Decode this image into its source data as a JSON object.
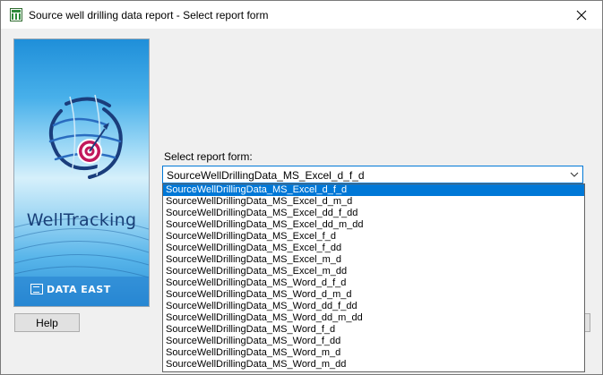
{
  "window": {
    "title": "Source well drilling data report - Select report form",
    "icon": "report-app-icon",
    "close_icon": "close-icon"
  },
  "banner": {
    "brand": "WellTracking",
    "company": "DATA EAST"
  },
  "form": {
    "label": "Select report form:",
    "selected": "SourceWellDrillingData_MS_Excel_d_f_d",
    "dropdown_open": true,
    "options": [
      "SourceWellDrillingData_MS_Excel_d_f_d",
      "SourceWellDrillingData_MS_Excel_d_m_d",
      "SourceWellDrillingData_MS_Excel_dd_f_dd",
      "SourceWellDrillingData_MS_Excel_dd_m_dd",
      "SourceWellDrillingData_MS_Excel_f_d",
      "SourceWellDrillingData_MS_Excel_f_dd",
      "SourceWellDrillingData_MS_Excel_m_d",
      "SourceWellDrillingData_MS_Excel_m_dd",
      "SourceWellDrillingData_MS_Word_d_f_d",
      "SourceWellDrillingData_MS_Word_d_m_d",
      "SourceWellDrillingData_MS_Word_dd_f_dd",
      "SourceWellDrillingData_MS_Word_dd_m_dd",
      "SourceWellDrillingData_MS_Word_f_d",
      "SourceWellDrillingData_MS_Word_f_dd",
      "SourceWellDrillingData_MS_Word_m_d",
      "SourceWellDrillingData_MS_Word_m_dd"
    ]
  },
  "buttons": {
    "help": "Help"
  },
  "colors": {
    "selection": "#0078d7",
    "brand_text": "#193f77",
    "dialog_bg": "#f0f0f0"
  }
}
